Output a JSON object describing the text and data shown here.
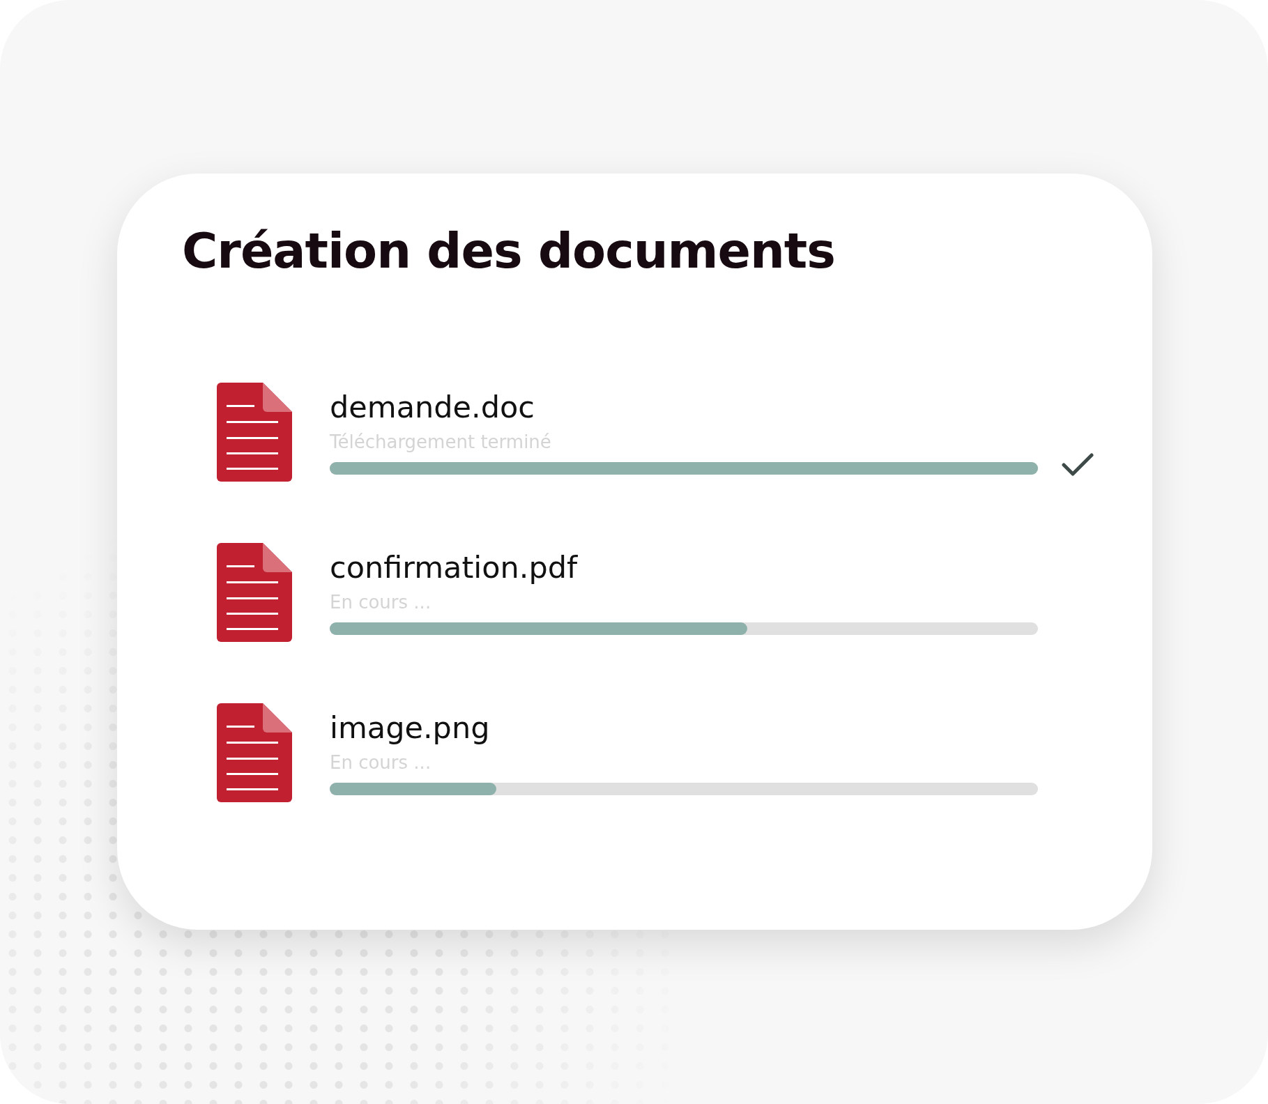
{
  "title": "Création des documents",
  "files": [
    {
      "name": "demande.doc",
      "status": "Téléchargement terminé",
      "level": 1,
      "done": true
    },
    {
      "name": "confirmation.pdf",
      "status": "En cours ...",
      "level": 0.59,
      "done": false
    },
    {
      "name": "image.png",
      "status": "En cours ...",
      "level": 0.235,
      "done": false
    }
  ]
}
